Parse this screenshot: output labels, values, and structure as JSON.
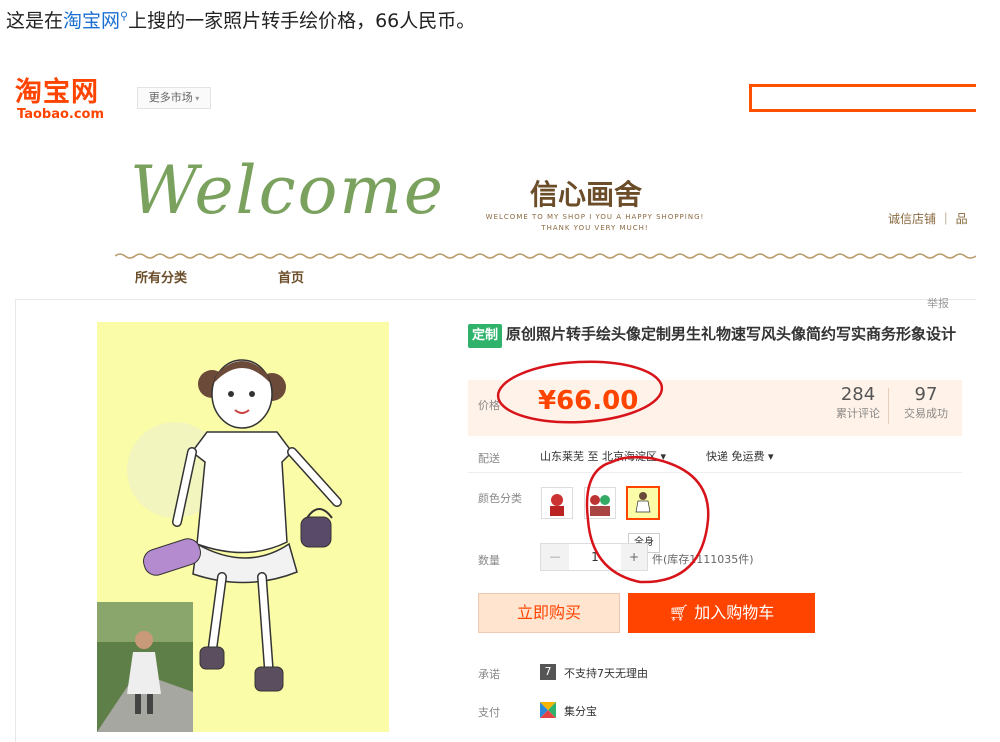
{
  "caption": {
    "before": "这是在",
    "link": "淘宝网",
    "after": "上搜的一家照片转手绘价格，66人民币。"
  },
  "taobao": {
    "logo_zh": "淘宝网",
    "logo_en": "Taobao.com",
    "market_label": "更多市场",
    "market_arrow": "chevron-down-icon"
  },
  "shop": {
    "welcome": "Welcome",
    "name": "信心画舍",
    "tagline1": "WELCOME TO MY SHOP I YOU A HAPPY SHOPPING!",
    "tagline2": "THANK YOU VERY MUCH!",
    "links": "诚信店铺 ｜ 品",
    "nav": [
      "所有分类",
      "首页"
    ]
  },
  "product": {
    "report": "举报",
    "badge": "定制",
    "title": "原创照片转手绘头像定制男生礼物速写风头像简约写实商务形象设计",
    "price_label": "价格",
    "price": "¥66.00",
    "reviews_count": "284",
    "reviews_label": "累计评论",
    "deals_count": "97",
    "deals_label": "交易成功",
    "shipping_label": "配送",
    "shipping_route": "山东莱芜 至 北京海淀区",
    "shipping_method": "快递 免运费",
    "color_label": "颜色分类",
    "selected_option_tip": "全身",
    "qty_label": "数量",
    "qty_value": "1",
    "qty_minus": "—",
    "qty_plus": "+",
    "stock": "件(库存1111035件)",
    "buy_now": "立即购买",
    "add_cart": "加入购物车",
    "promise_label": "承诺",
    "promise_text": "不支持7天无理由",
    "promise_icon_text": "7",
    "pay_label": "支付",
    "pay_text": "集分宝"
  },
  "colors": {
    "taobao_orange": "#ff4400",
    "badge_green": "#2fb36b",
    "annotation_red": "#d8141b",
    "photo_bg": "#fbfca8"
  }
}
